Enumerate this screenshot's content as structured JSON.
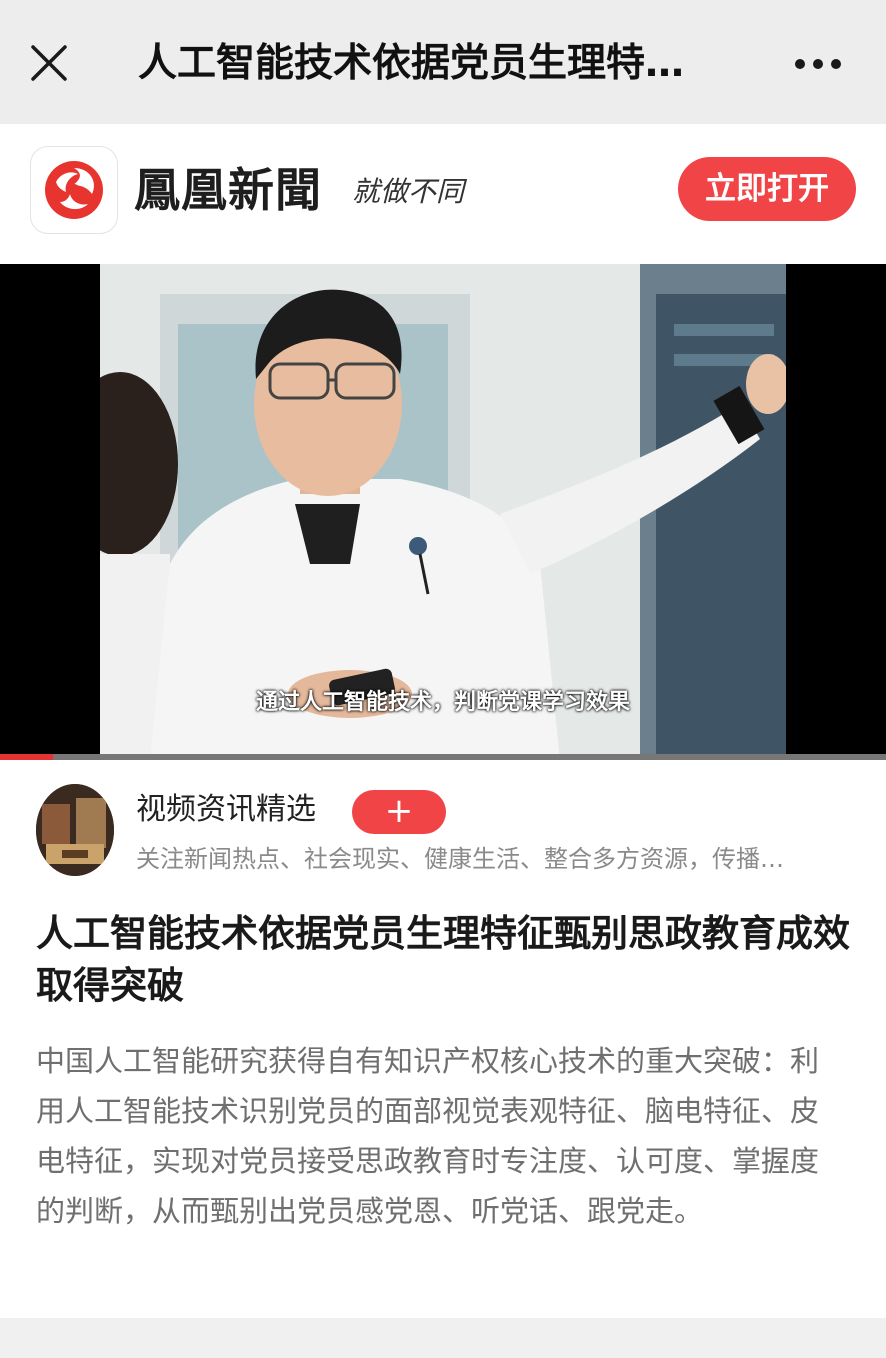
{
  "topbar": {
    "title": "人工智能技术依据党员生理特…",
    "close_icon": "close-icon",
    "more_icon": "more-dots-icon"
  },
  "brand": {
    "name": "鳳凰新聞",
    "slogan": "就做不同",
    "open_button": "立即打开",
    "logo_icon": "phoenix-logo-icon",
    "accent_color": "#f04446"
  },
  "video": {
    "subtitle": "通过人工智能技术，判断党课学习效果",
    "progress": 0.06
  },
  "channel": {
    "name": "视频资讯精选",
    "follow_label": "+",
    "description": "关注新闻热点、社会现实、健康生活、整合多方资源，传播…"
  },
  "article": {
    "title": "人工智能技术依据党员生理特征甄别思政教育成效取得突破",
    "summary": "中国人工智能研究获得自有知识产权核心技术的重大突破：利用人工智能技术识别党员的面部视觉表观特征、脑电特征、皮电特征，实现对党员接受思政教育时专注度、认可度、掌握度的判断，从而甄别出党员感党恩、听党话、跟党走。"
  }
}
